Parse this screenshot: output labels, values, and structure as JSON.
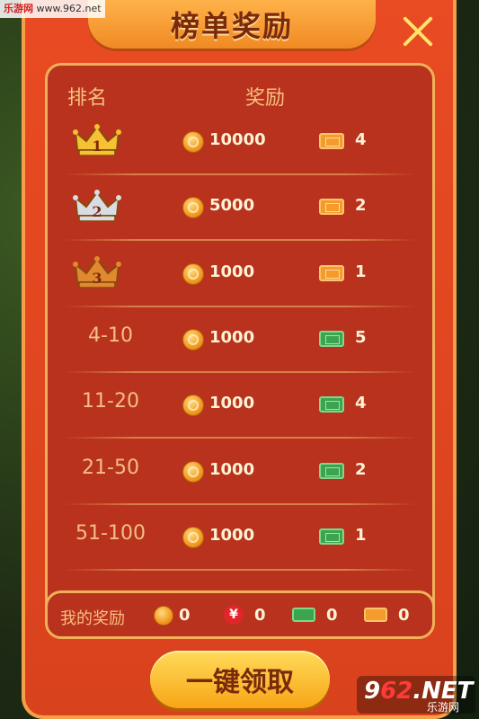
{
  "watermark": {
    "site_cn": "乐游网",
    "url": "www.962.net"
  },
  "title": "榜单奖励",
  "headers": {
    "rank": "排名",
    "reward": "奖励"
  },
  "rows": [
    {
      "rank": "1",
      "coins": "10000",
      "ticket_color": "orange",
      "tickets": "4",
      "crown": "gold"
    },
    {
      "rank": "2",
      "coins": "5000",
      "ticket_color": "orange",
      "tickets": "2",
      "crown": "silver"
    },
    {
      "rank": "3",
      "coins": "1000",
      "ticket_color": "orange",
      "tickets": "1",
      "crown": "bronze"
    },
    {
      "rank": "4-10",
      "coins": "1000",
      "ticket_color": "green",
      "tickets": "5"
    },
    {
      "rank": "11-20",
      "coins": "1000",
      "ticket_color": "green",
      "tickets": "4"
    },
    {
      "rank": "21-50",
      "coins": "1000",
      "ticket_color": "green",
      "tickets": "2"
    },
    {
      "rank": "51-100",
      "coins": "1000",
      "ticket_color": "green",
      "tickets": "1"
    }
  ],
  "my_rewards": {
    "label": "我的奖励",
    "coins": "0",
    "yen_symbol": "¥",
    "yen": "0",
    "green_tickets": "0",
    "orange_tickets": "0"
  },
  "claim_button": "一键领取",
  "logo": {
    "big_prefix": "9",
    "big_red": "62",
    "big_suffix": ".NET",
    "small": "乐游网"
  },
  "colors": {
    "gold": "#f5c232",
    "silver": "#d8dde4",
    "bronze": "#e0892e"
  }
}
